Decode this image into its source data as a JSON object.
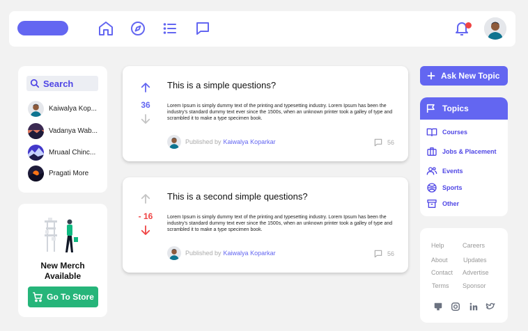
{
  "nav": {
    "icons": [
      "home-icon",
      "compass-icon",
      "list-icon",
      "chat-icon"
    ],
    "notification_icon": "bell-icon"
  },
  "search": {
    "label": "Search"
  },
  "users": [
    {
      "name": "Kaiwalya Kop..."
    },
    {
      "name": "Vadanya Wab..."
    },
    {
      "name": "Mruaal Chinc..."
    },
    {
      "name": "Pragati More"
    }
  ],
  "merch": {
    "title_line1": "New Merch",
    "title_line2": "Available",
    "button_label": "Go To Store"
  },
  "questions": [
    {
      "title": "This is a simple questions?",
      "votes": "36",
      "body": "Lorem Ipsum is simply dummy text of the printing and typesetting industry. Lorem Ipsum has been the industry's standard dummy text ever since the 1500s, when an unknown printer took a galley of type and scrambled it to make a type specimen book.",
      "published_label": "Published by",
      "author": "Kaiwalya Koparkar",
      "comments": "56"
    },
    {
      "title": "This is a second simple questions?",
      "votes": "- 16",
      "body": "Lorem Ipsum is simply dummy text of the printing and typesetting industry. Lorem Ipsum has been the industry's standard dummy text ever since the 1500s, when an unknown printer took a galley of type and scrambled it to make a type specimen book.",
      "published_label": "Published by",
      "author": "Kaiwalya Koparkar",
      "comments": "56"
    }
  ],
  "ask_button": "Ask New Topic",
  "topics": {
    "heading": "Topics",
    "items": [
      {
        "label": "Courses",
        "icon": "book-icon"
      },
      {
        "label": "Jobs & Placement",
        "icon": "briefcase-icon"
      },
      {
        "label": "Events",
        "icon": "people-icon"
      },
      {
        "label": "Sports",
        "icon": "ball-icon"
      },
      {
        "label": "Other",
        "icon": "archive-icon"
      }
    ]
  },
  "footer_links": [
    [
      "Help",
      "Careers"
    ],
    [
      "About",
      "Updates"
    ],
    [
      "Contact",
      "Advertise"
    ],
    [
      "Terms",
      "Sponsor"
    ]
  ],
  "social_icons": [
    "github-icon",
    "instagram-icon",
    "linkedin-icon",
    "twitter-icon"
  ],
  "colors": {
    "accent": "#6366f1",
    "success": "#26b57a",
    "downvote": "#ef4444",
    "notification": "#ef4444"
  }
}
